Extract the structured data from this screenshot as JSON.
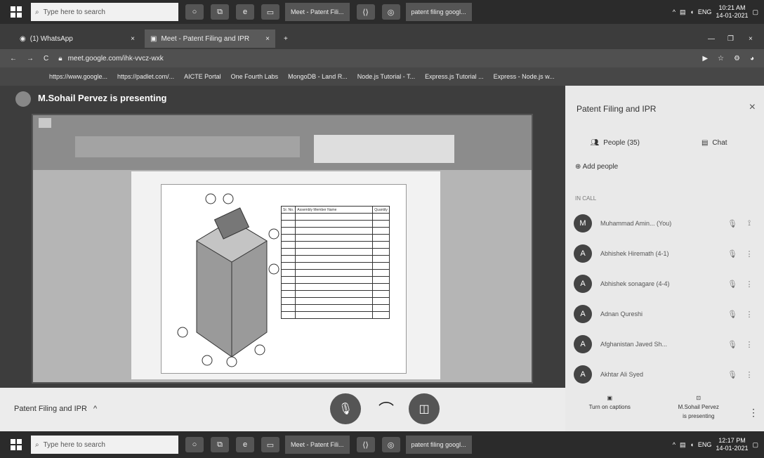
{
  "taskbar_top": {
    "search_placeholder": "Type here to search",
    "apps": [
      "Meet - Patent Fili...",
      "patent filing googl..."
    ],
    "lang": "ENG",
    "time": "10:21 AM",
    "date": "14-01-2021"
  },
  "browser": {
    "tabs": [
      {
        "label": "(1) WhatsApp"
      },
      {
        "label": "Meet - Patent Filing and IPR"
      }
    ],
    "url": "meet.google.com/ihk-vvcz-wxk",
    "bookmarks": [
      "https://www.google...",
      "https://padlet.com/...",
      "AICTE Portal",
      "One Fourth Labs",
      "MongoDB - Land R...",
      "Node.js Tutorial - T...",
      "Express.js Tutorial ...",
      "Express - Node.js w..."
    ]
  },
  "stage": {
    "presenting_text": "M.Sohail Pervez is presenting",
    "table_header": [
      "Sr. No.",
      "Assembly Member Name",
      "Quantity"
    ]
  },
  "panel": {
    "title": "Patent Filing and IPR",
    "people_tab": "People (35)",
    "chat_tab": "Chat",
    "add_people": "Add people",
    "in_call_label": "IN CALL",
    "people": [
      {
        "name": "Muhammad Amin... (You)",
        "initial": "M"
      },
      {
        "name": "Abhishek Hiremath (4-1)",
        "initial": "A"
      },
      {
        "name": "Abhishek sonagare (4-4)",
        "initial": "A"
      },
      {
        "name": "Adnan Qureshi",
        "initial": "A"
      },
      {
        "name": "Afghanistan Javed Sh...",
        "initial": "A"
      },
      {
        "name": "Akhtar Ali Syed",
        "initial": "A"
      }
    ],
    "bottom": {
      "captions": "Turn on captions",
      "presenter_line1": "M.Sohail Pervez",
      "presenter_line2": "is presenting"
    }
  },
  "meetbar": {
    "meeting_name": "Patent Filing and IPR"
  },
  "taskbar_bottom": {
    "search_placeholder": "Type here to search",
    "apps": [
      "Meet - Patent Fili...",
      "patent filing googl..."
    ],
    "lang": "ENG",
    "time": "12:17 PM",
    "date": "14-01-2021"
  }
}
